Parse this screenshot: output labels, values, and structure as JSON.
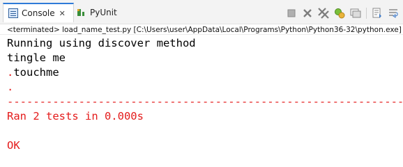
{
  "tabs": [
    {
      "label": "Console",
      "icon": "console-icon",
      "active": true
    },
    {
      "label": "PyUnit",
      "icon": "pyunit-icon",
      "active": false
    }
  ],
  "status": {
    "text": "<terminated> load_name_test.py [C:\\Users\\user\\AppData\\Local\\Programs\\Python\\Python36-32\\python.exe]"
  },
  "console": {
    "lines": [
      {
        "text": "Running using discover method",
        "stream": "stdout"
      },
      {
        "text": "tingle me",
        "stream": "stdout"
      },
      {
        "text": ".touchme",
        "stream": "mixed"
      },
      {
        "text": ".",
        "stream": "stderr"
      },
      {
        "text": "----------------------------------------------------------------------",
        "stream": "stderr"
      },
      {
        "text": "Ran 2 tests in 0.000s",
        "stream": "stderr"
      },
      {
        "text": "",
        "stream": "stderr"
      },
      {
        "text": "OK",
        "stream": "stderr"
      }
    ]
  },
  "colors": {
    "stdout": "#000000",
    "stderr": "#e41b1b",
    "active_tab_accent": "#2f7bd8"
  },
  "toolbar": {
    "icons": [
      "stop-icon",
      "remove-launch-icon",
      "remove-all-terminated-icon",
      "pin-console-icon",
      "display-console-icon",
      "scroll-lock-icon",
      "word-wrap-icon"
    ]
  }
}
